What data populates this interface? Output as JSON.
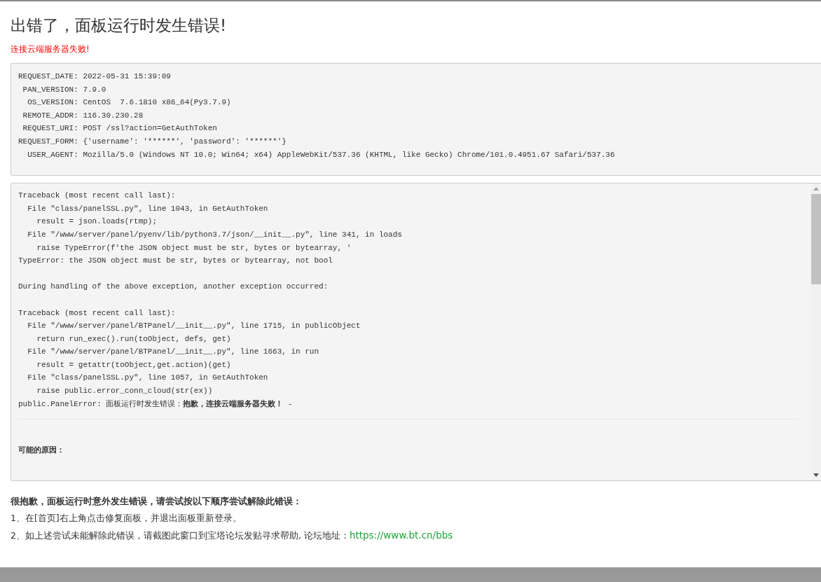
{
  "title": "出错了，面板运行时发生错误!",
  "subtitle": "连接云端服务器失败!",
  "request_info": [
    "REQUEST_DATE: 2022-05-31 15:39:09",
    " PAN_VERSION: 7.9.0",
    "  OS_VERSION: CentOS  7.6.1810 x86_64(Py3.7.9)",
    " REMOTE_ADDR: 116.30.230.28",
    " REQUEST_URI: POST /ssl?action=GetAuthToken",
    "REQUEST_FORM: {'username': '******', 'password': '******'}",
    "  USER_AGENT: Mozilla/5.0 (Windows NT 10.0; Win64; x64) AppleWebKit/537.36 (KHTML, like Gecko) Chrome/101.0.4951.67 Safari/537.36"
  ],
  "traceback": [
    [
      "Traceback (most recent call last):",
      "  File \"class/panelSSL.py\", line 1043, in GetAuthToken",
      "    result = json.loads(rtmp);",
      "  File \"/www/server/panel/pyenv/lib/python3.7/json/__init__.py\", line 341, in loads",
      "    raise TypeError(f'the JSON object must be str, bytes or bytearray, '",
      "TypeError: the JSON object must be str, bytes or bytearray, not bool"
    ],
    [
      "During handling of the above exception, another exception occurred:"
    ],
    [
      "Traceback (most recent call last):",
      "  File \"/www/server/panel/BTPanel/__init__.py\", line 1715, in publicObject",
      "    return run_exec().run(toObject, defs, get)",
      "  File \"/www/server/panel/BTPanel/__init__.py\", line 1663, in run",
      "    result = getattr(toObject,get.action)(get)",
      "  File \"class/panelSSL.py\", line 1057, in GetAuthToken",
      "    raise public.error_conn_cloud(str(ex))",
      "public.PanelError: 面板运行时发生错误：**抱歉，连接云端服务器失败！** -"
    ]
  ],
  "causes_heading": "可能的原因：",
  "help": {
    "heading": "很抱歉，面板运行时意外发生错误，请尝试按以下顺序尝试解除此错误：",
    "steps": [
      {
        "text": "1、在[首页]右上角点击修复面板，并退出面板重新登录。"
      },
      {
        "text": "2、如上述尝试未能解除此错误，请截图此窗口到宝塔论坛发贴寻求帮助, 论坛地址：",
        "link": "https://www.bt.cn/bbs"
      }
    ]
  }
}
